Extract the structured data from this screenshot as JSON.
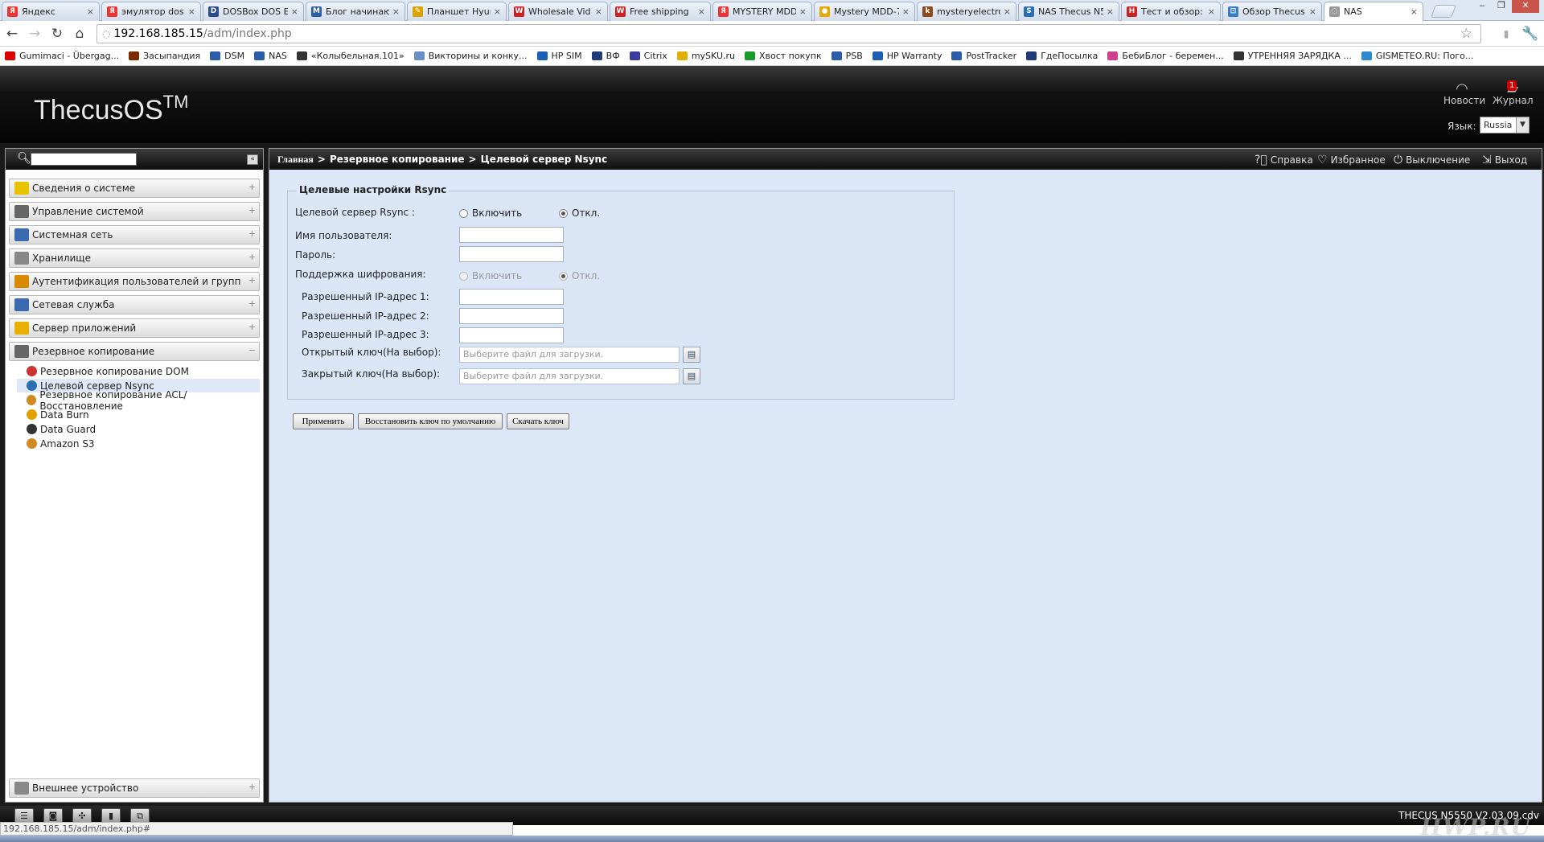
{
  "browser": {
    "tabs": [
      {
        "title": "Яндекс",
        "fav_color": "#e33",
        "fav_glyph": "Я"
      },
      {
        "title": "эмулятор dos",
        "fav_color": "#e33",
        "fav_glyph": "Я"
      },
      {
        "title": "DOSBox DOS E",
        "fav_color": "#2b4c8c",
        "fav_glyph": "D"
      },
      {
        "title": "Блог начинаю",
        "fav_color": "#2b5ca8",
        "fav_glyph": "M"
      },
      {
        "title": "Планшет Hyun",
        "fav_color": "#d9a400",
        "fav_glyph": "✎"
      },
      {
        "title": "Wholesale Vid",
        "fav_color": "#c22",
        "fav_glyph": "W"
      },
      {
        "title": "Free shipping",
        "fav_color": "#c22",
        "fav_glyph": "W"
      },
      {
        "title": "MYSTERY MDD-",
        "fav_color": "#e33",
        "fav_glyph": "Я"
      },
      {
        "title": "Mystery MDD-7",
        "fav_color": "#e8a800",
        "fav_glyph": "●"
      },
      {
        "title": "mysteryelectror",
        "fav_color": "#8b4a1a",
        "fav_glyph": "k"
      },
      {
        "title": "NAS Thecus N5",
        "fav_color": "#2a6fb5",
        "fav_glyph": "S"
      },
      {
        "title": "Тест и обзор: T",
        "fav_color": "#c22",
        "fav_glyph": "H"
      },
      {
        "title": "Обзор Thecus",
        "fav_color": "#3a7bc8",
        "fav_glyph": "⊡"
      },
      {
        "title": "NAS",
        "fav_color": "#999",
        "fav_glyph": "◌"
      }
    ],
    "url_host": "192.168.185.15",
    "url_path": "/adm/index.php",
    "bookmarks": [
      {
        "label": "Gumimaci - Übergag...",
        "color": "#d00"
      },
      {
        "label": "Засыпандия",
        "color": "#7a2c00"
      },
      {
        "label": "DSM",
        "color": "#2b5da8"
      },
      {
        "label": "NAS",
        "color": "#2b5da8"
      },
      {
        "label": "«Колыбельная.101»",
        "color": "#333"
      },
      {
        "label": "Викторины и конку...",
        "color": "#6a8fc4"
      },
      {
        "label": "HP SIM",
        "color": "#1a5fb4"
      },
      {
        "label": "ВФ",
        "color": "#223a78"
      },
      {
        "label": "Citrix",
        "color": "#3a3aa0"
      },
      {
        "label": "mySKU.ru",
        "color": "#e0b000"
      },
      {
        "label": "Хвост покупк",
        "color": "#1a9a2a"
      },
      {
        "label": "PSB",
        "color": "#2b5da8"
      },
      {
        "label": "HP Warranty",
        "color": "#1a5fb4"
      },
      {
        "label": "PostTracker",
        "color": "#2b5da8"
      },
      {
        "label": "ГдеПосылка",
        "color": "#223a78"
      },
      {
        "label": "БебиБлог - беремен...",
        "color": "#d04090"
      },
      {
        "label": "УТРЕННЯЯ ЗАРЯДКА ...",
        "color": "#333"
      },
      {
        "label": "GISMETEO.RU: Пого...",
        "color": "#2b8ad0"
      }
    ],
    "status_url": "192.168.185.15/adm/index.php#"
  },
  "app": {
    "logo": "ThecusOS",
    "logo_tm": "TM",
    "news_label": "Новости",
    "journal_label": "Журнал",
    "journal_badge": "1",
    "lang_label": "Язык:",
    "lang_value": "Russia",
    "version": "THECUS N5550 V2.03.09.cdv",
    "watermark": "HWP.RU"
  },
  "sidebar": {
    "menus": [
      {
        "label": "Сведения о системе",
        "icon": "info-icon",
        "color": "#e8c400"
      },
      {
        "label": "Управление системой",
        "icon": "tools-icon",
        "color": "#666"
      },
      {
        "label": "Системная сеть",
        "icon": "network-icon",
        "color": "#3a6bb0"
      },
      {
        "label": "Хранилище",
        "icon": "storage-icon",
        "color": "#888"
      },
      {
        "label": "Аутентификация пользователей и групп",
        "icon": "users-icon",
        "color": "#d88a00"
      },
      {
        "label": "Сетевая служба",
        "icon": "service-icon",
        "color": "#3a6bb0"
      },
      {
        "label": "Сервер приложений",
        "icon": "app-server-icon",
        "color": "#e8b000"
      },
      {
        "label": "Резервное копирование",
        "icon": "backup-icon",
        "color": "#666"
      }
    ],
    "backup_items": [
      {
        "label": "Резервное копирование DOM",
        "color": "#c33"
      },
      {
        "label": "Целевой сервер Nsync",
        "color": "#2a6fb5"
      },
      {
        "label": "Резервное копирование ACL/Восстановление",
        "color": "#d08a20"
      },
      {
        "label": "Data Burn",
        "color": "#e0a000"
      },
      {
        "label": "Data Guard",
        "color": "#333"
      },
      {
        "label": "Amazon S3",
        "color": "#d08a20"
      }
    ],
    "external_label": "Внешнее устройство"
  },
  "breadcrumb": {
    "home": "Главная",
    "sep": ">",
    "section": "Резервное копирование",
    "page": "Целевой сервер Nsync"
  },
  "top_actions": {
    "help": "Справка",
    "favorites": "Избранное",
    "shutdown": "Выключение",
    "logout": "Выход"
  },
  "form": {
    "legend": "Целевые настройки Rsync",
    "rsync_label": "Целевой сервер Rsync :",
    "enable": "Включить",
    "disable": "Откл.",
    "username_label": "Имя пользователя:",
    "password_label": "Пароль:",
    "encryption_label": "Поддержка шифрования:",
    "ip1_label": "Разрешенный IP-адрес 1:",
    "ip2_label": "Разрешенный IP-адрес 2:",
    "ip3_label": "Разрешенный IP-адрес 3:",
    "public_key_label": "Открытый ключ(На выбор):",
    "private_key_label": "Закрытый ключ(На выбор):",
    "file_placeholder": "Выберите файл для загрузки.",
    "username_value": "",
    "password_value": "",
    "ip1_value": "",
    "ip2_value": "",
    "ip3_value": ""
  },
  "buttons": {
    "apply": "Применить",
    "restore_key": "Восстановить ключ по умолчанию",
    "download_key": "Скачать ключ"
  }
}
